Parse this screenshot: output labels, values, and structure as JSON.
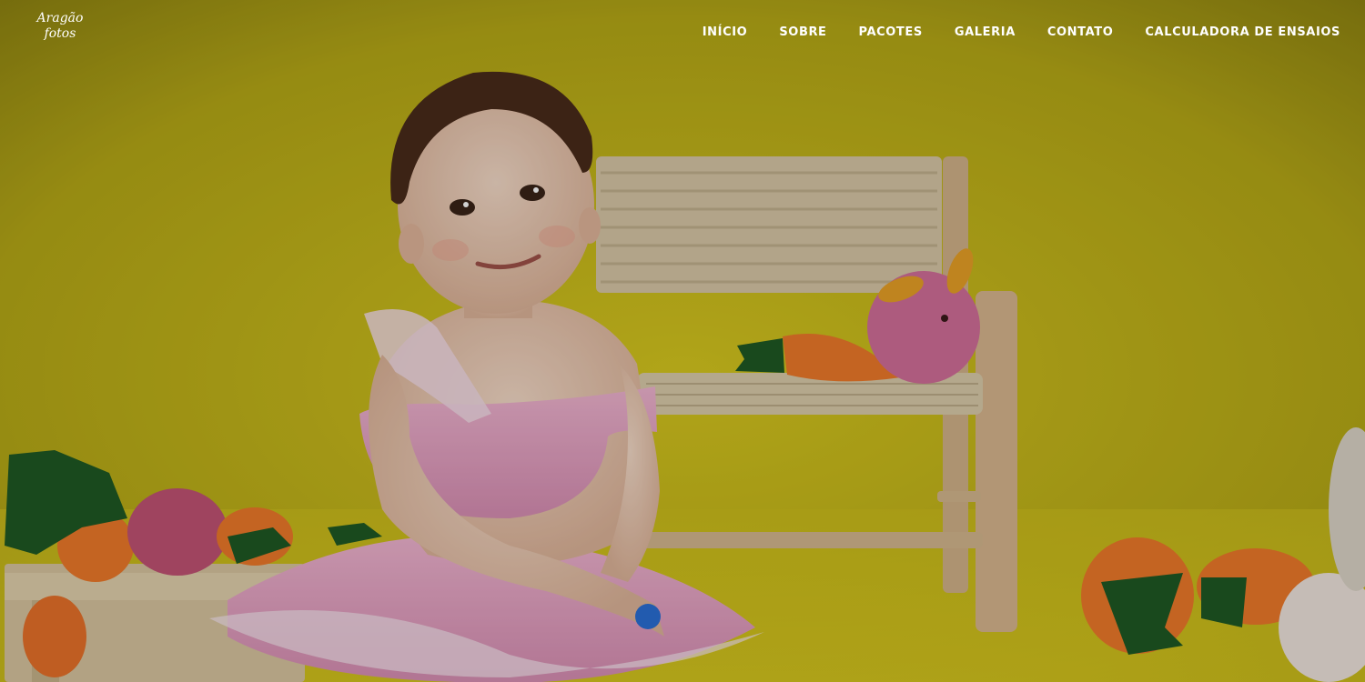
{
  "logo": {
    "line1": "Aragão",
    "line2": "fotos"
  },
  "nav": {
    "items": [
      {
        "label": "INÍCIO"
      },
      {
        "label": "SOBRE"
      },
      {
        "label": "PACOTES"
      },
      {
        "label": "GALERIA"
      },
      {
        "label": "CONTATO"
      },
      {
        "label": "CALCULADORA DE ENSAIOS"
      }
    ]
  },
  "hero": {
    "image_description_icon": "photo-toddler-easter-bunny-set",
    "colors": {
      "backdrop": "#c9bb1c",
      "dress": "#e8a9c8",
      "carrot": "#f07a2a",
      "bench": "#d9c9a8"
    }
  }
}
